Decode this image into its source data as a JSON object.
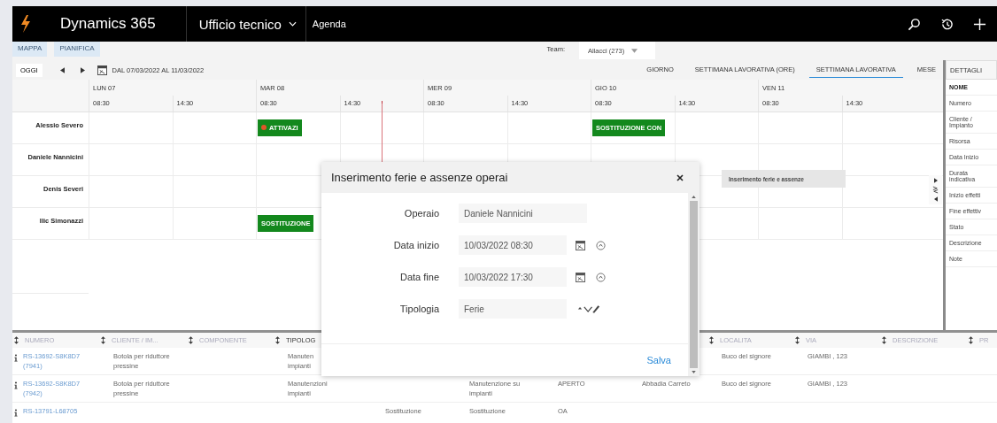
{
  "top_bar": {
    "app_name": "Dynamics 365",
    "area": "Ufficio tecnico",
    "page": "Agenda"
  },
  "tabs": [
    "MAPPA",
    "PIANIFICA"
  ],
  "team": {
    "label": "Team:",
    "value": "Allacci (273)"
  },
  "toolbar": {
    "today": "OGGI",
    "range": "DAL 07/03/2022 AL 11/03/2022",
    "views": [
      {
        "label": "GIORNO",
        "selected": false
      },
      {
        "label": "SETTIMANA LAVORATIVA (ORE)",
        "selected": false
      },
      {
        "label": "SETTIMANA LAVORATIVA",
        "selected": true
      },
      {
        "label": "MESE",
        "selected": false
      }
    ]
  },
  "calendar": {
    "days": [
      {
        "label": "LUN 07",
        "times": [
          "08:30",
          "14:30"
        ]
      },
      {
        "label": "MAR 08",
        "times": [
          "08:30",
          "14:30"
        ]
      },
      {
        "label": "MER 09",
        "times": [
          "08:30",
          "14:30"
        ]
      },
      {
        "label": "GIO 10",
        "times": [
          "08:30",
          "14:30"
        ]
      },
      {
        "label": "VEN 11",
        "times": [
          "08:30",
          "14:30"
        ]
      }
    ],
    "resources": [
      {
        "name": "Alessio Severo",
        "events": [
          {
            "kind": "tue_am",
            "label": "ATTIVAZI",
            "alert": true
          },
          {
            "kind": "thu_am",
            "label": "SOSTITUZIONE CON",
            "alert": false
          }
        ]
      },
      {
        "name": "Daniele Nannicini"
      },
      {
        "name": "Denis Severi"
      },
      {
        "name": "Ilic Simonazzi",
        "events": [
          {
            "kind": "tue_am",
            "label": "SOSTITUZIONE",
            "alert": false
          }
        ]
      }
    ],
    "drag_item": "Inserimento ferie e assenze"
  },
  "details": {
    "title": "DETTAGLI",
    "heading": "NOME",
    "fields": [
      "Numero",
      "Cliente / Impianto",
      "Risorsa",
      "Data Inizio",
      "Durata indicativa",
      "Inizio effetti",
      "Fine effettiv",
      "Stato",
      "Descrizione",
      "Note"
    ]
  },
  "dialog": {
    "title": "Inserimento ferie e assenze operai",
    "fields": [
      {
        "kind": "readonly",
        "label": "Operaio",
        "value": "Daniele Nannicini"
      },
      {
        "kind": "datetime",
        "label": "Data inizio",
        "value": "10/03/2022 08:30"
      },
      {
        "kind": "datetime",
        "label": "Data fine",
        "value": "10/03/2022 17:30"
      },
      {
        "kind": "lookup",
        "label": "Tipologia",
        "value": "Ferie"
      }
    ],
    "save": "Salva"
  },
  "grid": {
    "columns": [
      "NUMERO",
      "CLIENTE / IM...",
      "COMPONENTE",
      "TIPOLOG",
      null,
      null,
      null,
      null,
      "LOCALITA",
      "VIA",
      "DESCRIZIONE",
      "PR"
    ],
    "rows": [
      [
        "RS-13692-S8K8D7 (7941)",
        "Botola per riduttore pressine",
        null,
        "Manuten impianti",
        null,
        null,
        null,
        null,
        "Buco del signore",
        "GIAMBI , 123"
      ],
      [
        "RS-13692-S8K8D7 (7942)",
        "Botola per riduttore pressine",
        null,
        "Manutenzioni impianti",
        null,
        "Manutenzione su impianti",
        "APERTO",
        "Abbadia Carreto",
        "Buco del signore",
        "GIAMBI , 123"
      ],
      [
        "RS-13791-L68705",
        null,
        null,
        null,
        "Sostituzione",
        "Sostituzione",
        "OA"
      ]
    ]
  }
}
